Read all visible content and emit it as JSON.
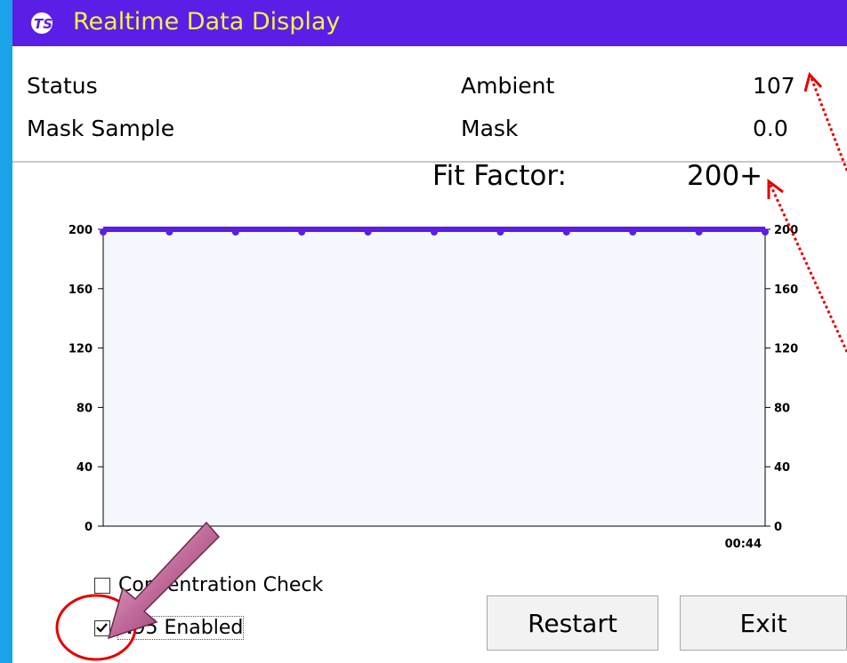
{
  "window": {
    "logo_text": "TSI",
    "title": "Realtime Data Display"
  },
  "readings": {
    "status_label": "Status",
    "mask_sample_label": "Mask Sample",
    "ambient_label": "Ambient",
    "ambient_value": "107",
    "mask_label": "Mask",
    "mask_value": "0.0"
  },
  "fit_factor": {
    "label": "Fit Factor:",
    "value": "200+"
  },
  "chart_data": {
    "type": "area",
    "x": [
      0,
      4.4,
      8.8,
      13.2,
      17.6,
      22,
      26.4,
      30.8,
      35.2,
      39.6,
      44
    ],
    "values": [
      200,
      200,
      200,
      200,
      200,
      200,
      200,
      200,
      200,
      200,
      200
    ],
    "ylim": [
      0,
      200
    ],
    "yticks": [
      "0",
      "40",
      "80",
      "120",
      "160",
      "200"
    ],
    "xlabel_time": "00:44",
    "line_color": "#5a1ee6",
    "fill_color": "#f5f7ff"
  },
  "options": {
    "concentration_check_label": "Concentration Check",
    "concentration_check_checked": false,
    "n95_label": "N95 Enabled",
    "n95_checked": true
  },
  "buttons": {
    "restart": "Restart",
    "exit": "Exit"
  },
  "colors": {
    "titlebar": "#5a1ee6",
    "title_text": "#f3f24a",
    "left_strip": "#1aa3e8",
    "annotation": "#e60000",
    "pointer_arrow": "#c06a9a"
  }
}
